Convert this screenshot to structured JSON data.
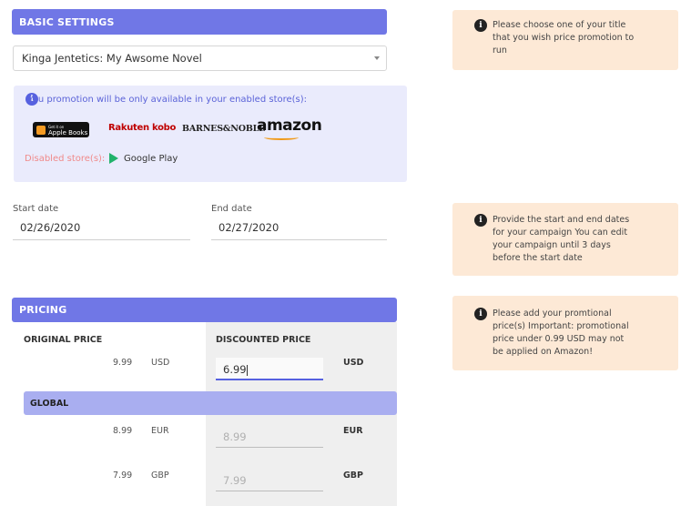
{
  "basic": {
    "header": "BASIC SETTINGS",
    "book_select": "Kinga Jentetics: My Awsome Novel"
  },
  "stores": {
    "note": "You promotion will be only available in your enabled store(s):",
    "enabled": [
      "Apple Books",
      "Rakuten kobo",
      "BARNES&NOBLE",
      "amazon"
    ],
    "apple_small": "Get it on",
    "disabled_label": "Disabled store(s):",
    "disabled": [
      "Google Play"
    ]
  },
  "dates": {
    "start_label": "Start date",
    "start_value": "02/26/2020",
    "end_label": "End date",
    "end_value": "02/27/2020"
  },
  "tips": [
    "Please choose one of your title that you wish price promotion to run",
    "Provide the start and end dates for your campaign You can edit your campaign until 3 days before the start date",
    "Please add your promtional price(s) Important: promotional price under 0.99 USD may not be applied on Amazon!"
  ],
  "tip_lines": [
    [
      "Please choose one of your title",
      "that you wish price promotion to",
      "run"
    ],
    [
      "Provide the start and end dates",
      "for your campaign You can edit",
      "your campaign until 3 days",
      "before the start date"
    ],
    [
      "Please add your promtional",
      "price(s) Important: promotional",
      "price under 0.99 USD may not",
      "be applied on Amazon!"
    ]
  ],
  "pricing": {
    "header": "PRICING",
    "original_head": "ORIGINAL PRICE",
    "discounted_head": "DISCOUNTED PRICE",
    "global_label": "GLOBAL",
    "rows": [
      {
        "original": "9.99",
        "currency": "USD",
        "discounted": "6.99",
        "disc_currency": "USD"
      },
      {
        "original": "8.99",
        "currency": "EUR",
        "discounted": "8.99",
        "disc_currency": "EUR"
      },
      {
        "original": "7.99",
        "currency": "GBP",
        "discounted": "7.99",
        "disc_currency": "GBP"
      }
    ]
  },
  "colors": {
    "accent": "#7077e6",
    "tip_bg": "#fde9d6",
    "store_bg": "#eaebfc",
    "global_bar": "#a9aef0"
  }
}
